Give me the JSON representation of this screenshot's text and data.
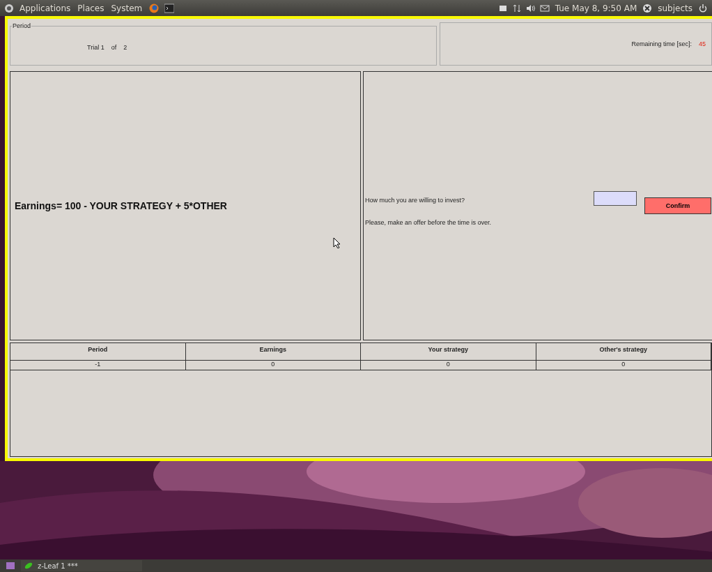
{
  "top_panel": {
    "menus": [
      "Applications",
      "Places",
      "System"
    ],
    "clock": "Tue May 8, 9:50 AM",
    "user": "subjects"
  },
  "period": {
    "legend": "Period",
    "trial_label": "Trial 1",
    "of_label": "of",
    "total": "2",
    "remaining_label": "Remaining time [sec]:",
    "remaining_value": "45"
  },
  "left_panel": {
    "formula": "Earnings= 100 - YOUR STRATEGY + 5*OTHER"
  },
  "right_panel": {
    "question": "How much you are willing to invest?",
    "hint": "Please, make an offer before the time is over.",
    "button": "Confirm"
  },
  "table": {
    "columns": [
      "Period",
      "Earnings",
      "Your strategy",
      "Other's strategy"
    ],
    "rows": [
      [
        "-1",
        "0",
        "0",
        "0"
      ]
    ]
  },
  "taskbar": {
    "items": [
      {
        "label": "z-Leaf 1 ***",
        "selected": false
      }
    ]
  }
}
